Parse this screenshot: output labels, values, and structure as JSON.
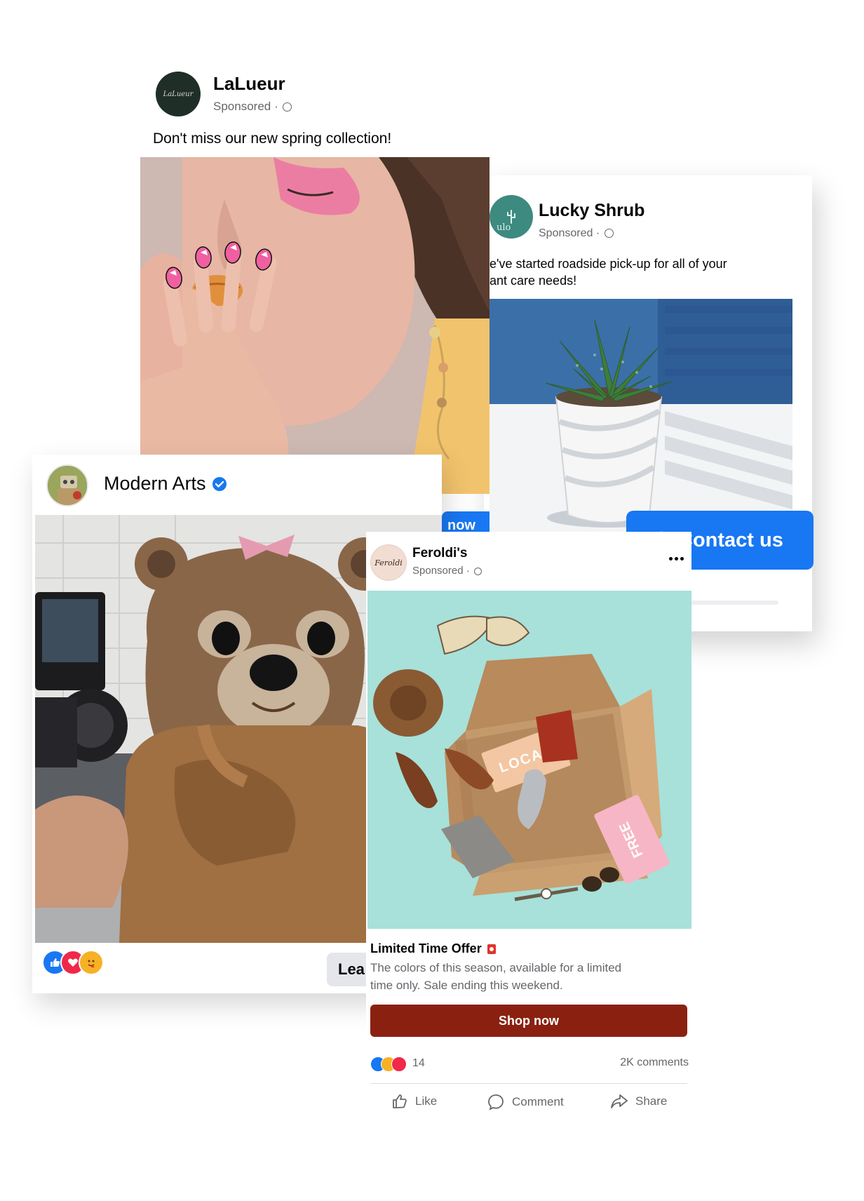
{
  "colors": {
    "facebook_blue": "#1877f2",
    "shop_button": "#8a2110",
    "muted_text": "#65676b",
    "feroldi_image_bg": "#a7e1da"
  },
  "lalueur": {
    "brand": "LaLueur",
    "logo_text": "LaLueur",
    "sponsored": "Sponsored ·",
    "text": "Don't miss our new spring collection!"
  },
  "lucky": {
    "brand": "Lucky Shrub",
    "logo_text": "ulo",
    "sponsored": "Sponsored ·",
    "text_line1": "e've started roadside pick-up for all of your",
    "text_line2": "ant care needs!",
    "cta": "Contact us",
    "cta_icon": "message-icon"
  },
  "modern": {
    "brand": "Modern Arts",
    "verified_icon": "verified-badge-icon",
    "button_partial": "Lea",
    "button_partial_other": "now"
  },
  "feroldi": {
    "brand": "Feroldi's",
    "logo_text": "Feroldi",
    "sponsored": "Sponsored ·",
    "more_icon": "more-options-icon",
    "box_card_text": "LOCAL",
    "tag_text": "FREE",
    "offer_title": "Limited Time Offer",
    "offer_desc_line1": "The colors of this season, available for a limited",
    "offer_desc_line2": "time only. Sale ending this weekend.",
    "cta": "Shop now",
    "reaction_count": "14",
    "comments": "2K comments",
    "like": "Like",
    "comment": "Comment",
    "share": "Share"
  }
}
